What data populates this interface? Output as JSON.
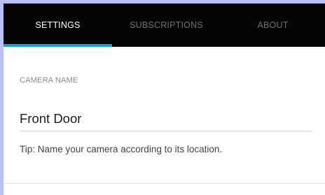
{
  "tabs": [
    {
      "label": "SETTINGS",
      "active": true
    },
    {
      "label": "SUBSCRIPTIONS",
      "active": false
    },
    {
      "label": "ABOUT",
      "active": false
    }
  ],
  "camera_name": {
    "label": "CAMERA NAME",
    "value": "Front Door",
    "tip": "Tip: Name your camera according to its location."
  },
  "colors": {
    "page_background": "#b9c2f2",
    "tab_bar": "#050505",
    "active_tab_indicator": "#1a9ee6",
    "active_tab_text": "#ffffff",
    "inactive_tab_text": "#6f6f6f"
  }
}
